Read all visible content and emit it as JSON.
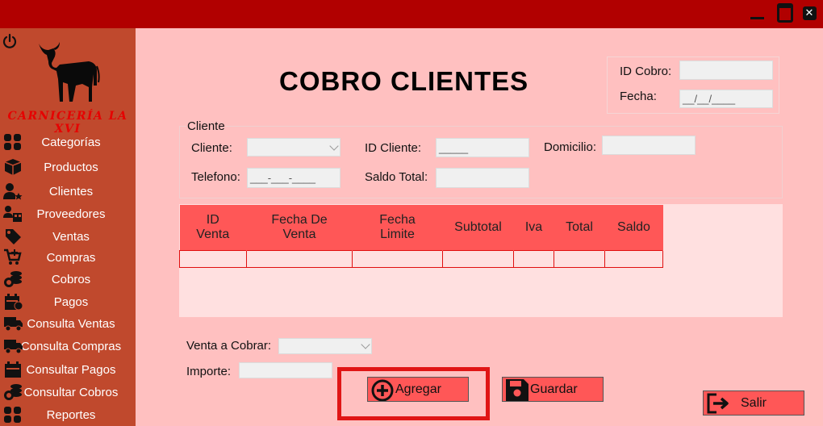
{
  "window": {
    "minimize": "",
    "maximize": "",
    "close": "✕"
  },
  "sidebar": {
    "brand": "CARNICERÍA LA XVI",
    "items": [
      {
        "label": "Categorías",
        "icon": "grid-icon"
      },
      {
        "label": "Productos",
        "icon": "boxes-icon"
      },
      {
        "label": "Clientes",
        "icon": "user-star-icon"
      },
      {
        "label": "Proveedores",
        "icon": "users-icon"
      },
      {
        "label": "Ventas",
        "icon": "tag-icon"
      },
      {
        "label": "Compras",
        "icon": "cart-plus-icon"
      },
      {
        "label": "Cobros",
        "icon": "coins-icon"
      },
      {
        "label": "Pagos",
        "icon": "calendar-dollar-icon"
      },
      {
        "label": "Consulta Ventas",
        "icon": "truck-icon"
      },
      {
        "label": "Consulta Compras",
        "icon": "truck-icon"
      },
      {
        "label": "Consultar Pagos",
        "icon": "calendar-icon"
      },
      {
        "label": "Consultar Cobros",
        "icon": "coins-icon"
      },
      {
        "label": "Reportes",
        "icon": "grid-icon"
      }
    ]
  },
  "header": {
    "title": "COBRO CLIENTES"
  },
  "cobro": {
    "id_label": "ID Cobro:",
    "id_value": "",
    "fecha_label": "Fecha:",
    "fecha_value": "__/__/____"
  },
  "cliente": {
    "legend": "Cliente",
    "cliente_label": "Cliente:",
    "cliente_value": "",
    "id_label": "ID Cliente:",
    "id_value": "_____",
    "domicilio_label": "Domicilio:",
    "domicilio_value": "",
    "telefono_label": "Telefono:",
    "telefono_value": "___-___-____",
    "saldo_label": "Saldo Total:",
    "saldo_value": ""
  },
  "table": {
    "columns": [
      "ID\nVenta",
      "Fecha De\nVenta",
      "Fecha\nLimite",
      "Subtotal",
      "Iva",
      "Total",
      "Saldo"
    ],
    "rows": [
      [
        "",
        "",
        "",
        "",
        "",
        "",
        ""
      ]
    ]
  },
  "form": {
    "venta_label": "Venta a Cobrar:",
    "venta_value": "",
    "importe_label": "Importe:",
    "importe_value": ""
  },
  "buttons": {
    "agregar": "Agregar",
    "guardar": "Guardar",
    "salir": "Salir"
  },
  "colors": {
    "titlebar": "#b10000",
    "sidebar": "#c0492d",
    "background": "#ffc0c0",
    "accent": "#ff5757",
    "highlight": "#e01515"
  }
}
